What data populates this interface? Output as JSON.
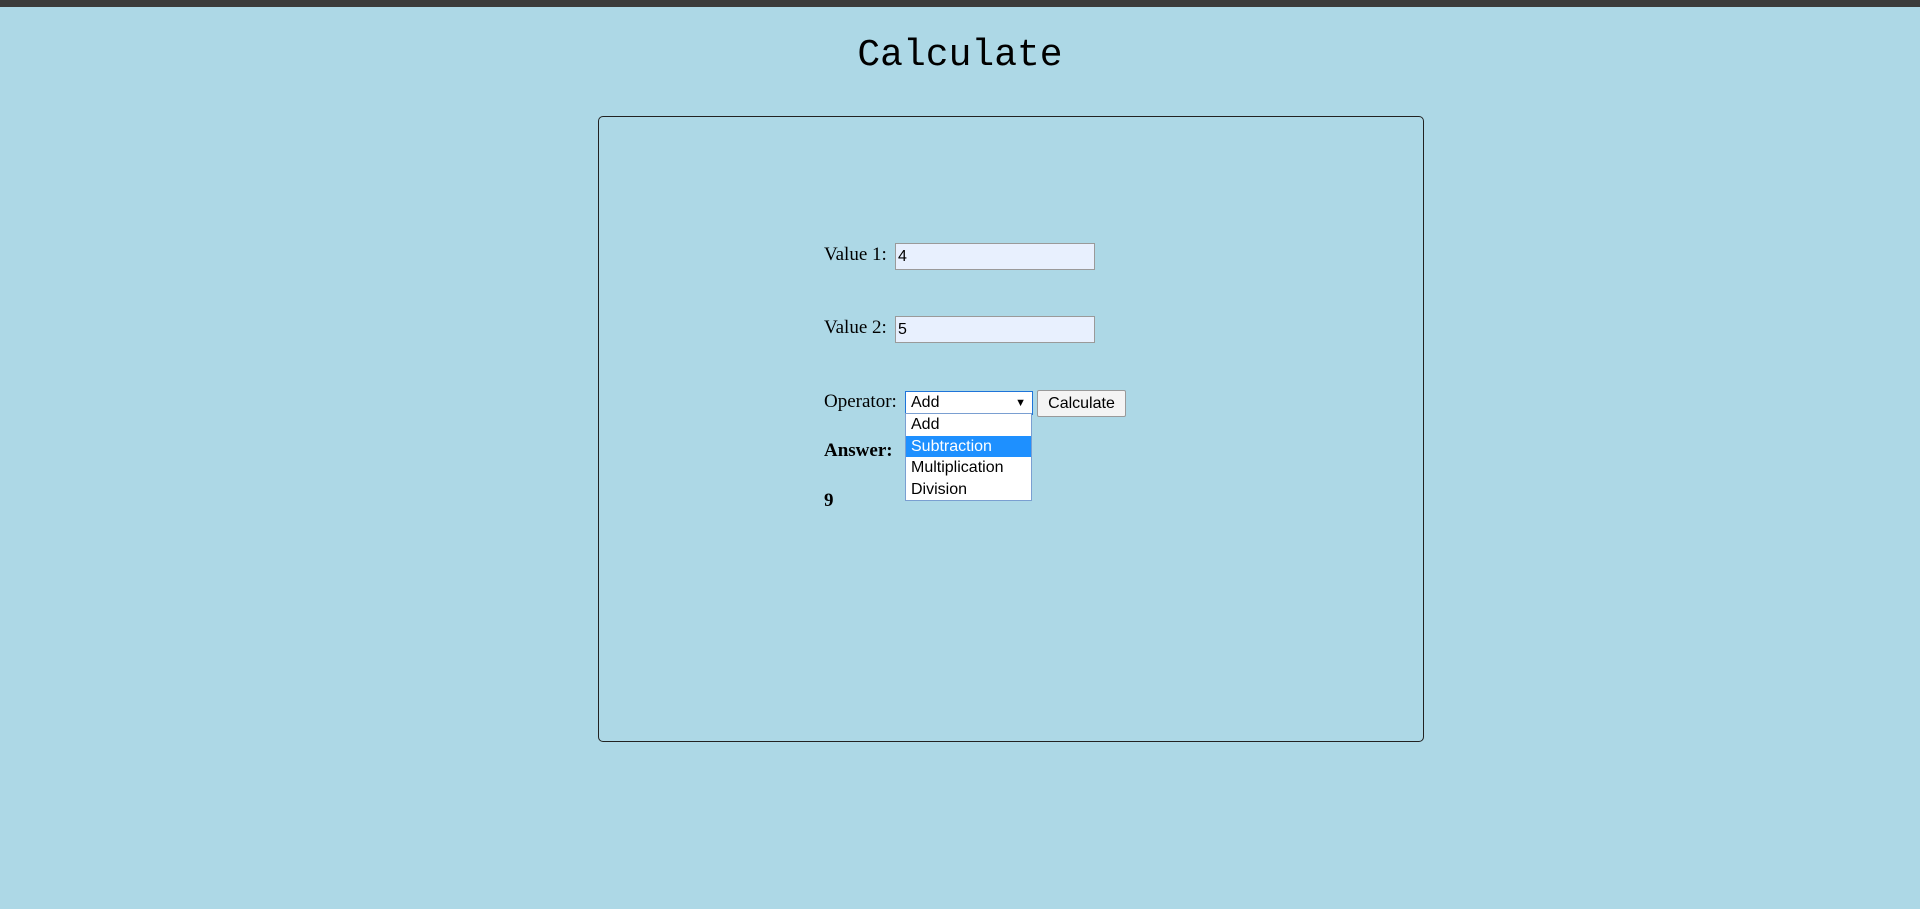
{
  "page": {
    "title": "Calculate"
  },
  "form": {
    "value1_label": "Value 1:",
    "value1": "4",
    "value2_label": "Value 2:",
    "value2": "5",
    "operator_label": "Operator:",
    "operator_selected": "Add",
    "operator_options": [
      "Add",
      "Subtraction",
      "Multiplication",
      "Division"
    ],
    "highlighted_option": "Subtraction",
    "calculate_label": "Calculate"
  },
  "result": {
    "answer_label": "Answer:",
    "answer_value": "9"
  },
  "colors": {
    "background": "#add8e6",
    "input_bg": "#e8f0fe",
    "highlight": "#1e90ff"
  }
}
